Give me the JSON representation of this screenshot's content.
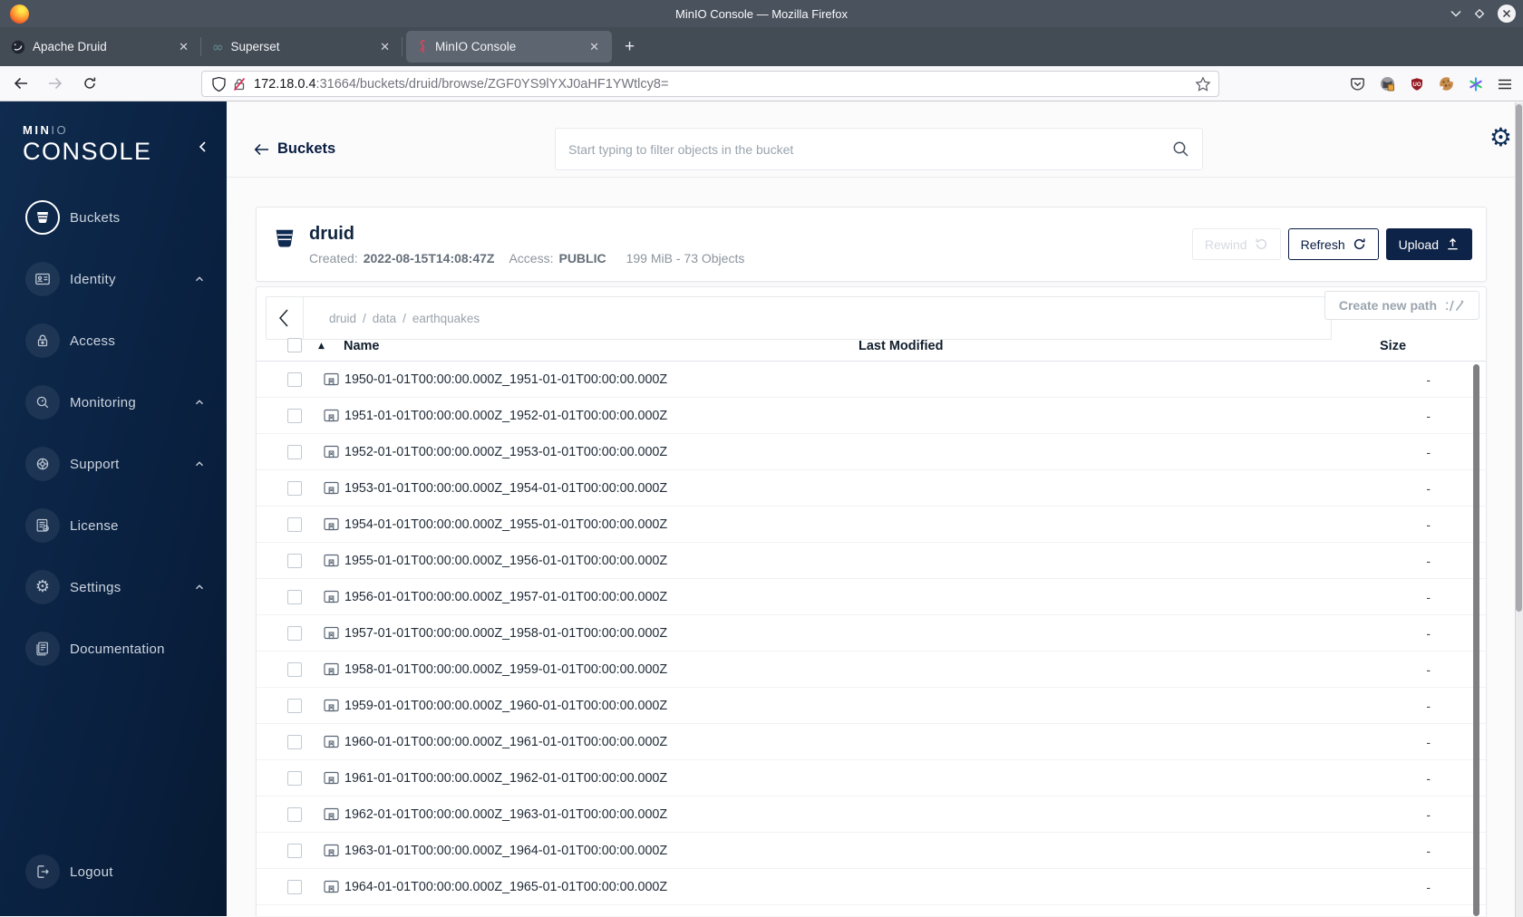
{
  "window": {
    "title": "MinIO Console — Mozilla Firefox"
  },
  "tabs": [
    {
      "label": "Apache Druid",
      "close": "✕"
    },
    {
      "label": "Superset",
      "close": "✕"
    },
    {
      "label": "MinIO Console",
      "close": "✕",
      "active": true
    }
  ],
  "browser": {
    "url_host": "172.18.0.4",
    "url_rest": ":31664/buckets/druid/browse/ZGF0YS9lYXJ0aHF1YWtlcy8="
  },
  "sidebar": {
    "logo_top": "MIN",
    "logo_top_light": "IO",
    "logo_main": "CONSOLE",
    "items": [
      {
        "label": "Buckets",
        "active": true,
        "has_chevron": false
      },
      {
        "label": "Identity",
        "active": false,
        "has_chevron": true
      },
      {
        "label": "Access",
        "active": false,
        "has_chevron": false
      },
      {
        "label": "Monitoring",
        "active": false,
        "has_chevron": true
      },
      {
        "label": "Support",
        "active": false,
        "has_chevron": true
      },
      {
        "label": "License",
        "active": false,
        "has_chevron": false
      },
      {
        "label": "Settings",
        "active": false,
        "has_chevron": true
      },
      {
        "label": "Documentation",
        "active": false,
        "has_chevron": false
      }
    ],
    "logout_label": "Logout"
  },
  "header": {
    "back_label": "Buckets",
    "search_placeholder": "Start typing to filter objects in the bucket"
  },
  "bucket": {
    "name": "druid",
    "created_label": "Created:",
    "created": "2022-08-15T14:08:47Z",
    "access_label": "Access:",
    "access": "PUBLIC",
    "usage": "199 MiB - 73 Objects",
    "rewind_label": "Rewind",
    "refresh_label": "Refresh",
    "upload_label": "Upload"
  },
  "browse": {
    "breadcrumb": [
      "druid",
      "data",
      "earthquakes"
    ],
    "breadcrumb_separator": "/",
    "create_path_label": "Create new path",
    "columns": {
      "name": "Name",
      "last_modified": "Last Modified",
      "size": "Size"
    },
    "sort_indicator": "▲",
    "rows": [
      {
        "name": "1950-01-01T00:00:00.000Z_1951-01-01T00:00:00.000Z",
        "size": "-"
      },
      {
        "name": "1951-01-01T00:00:00.000Z_1952-01-01T00:00:00.000Z",
        "size": "-"
      },
      {
        "name": "1952-01-01T00:00:00.000Z_1953-01-01T00:00:00.000Z",
        "size": "-"
      },
      {
        "name": "1953-01-01T00:00:00.000Z_1954-01-01T00:00:00.000Z",
        "size": "-"
      },
      {
        "name": "1954-01-01T00:00:00.000Z_1955-01-01T00:00:00.000Z",
        "size": "-"
      },
      {
        "name": "1955-01-01T00:00:00.000Z_1956-01-01T00:00:00.000Z",
        "size": "-"
      },
      {
        "name": "1956-01-01T00:00:00.000Z_1957-01-01T00:00:00.000Z",
        "size": "-"
      },
      {
        "name": "1957-01-01T00:00:00.000Z_1958-01-01T00:00:00.000Z",
        "size": "-"
      },
      {
        "name": "1958-01-01T00:00:00.000Z_1959-01-01T00:00:00.000Z",
        "size": "-"
      },
      {
        "name": "1959-01-01T00:00:00.000Z_1960-01-01T00:00:00.000Z",
        "size": "-"
      },
      {
        "name": "1960-01-01T00:00:00.000Z_1961-01-01T00:00:00.000Z",
        "size": "-"
      },
      {
        "name": "1961-01-01T00:00:00.000Z_1962-01-01T00:00:00.000Z",
        "size": "-"
      },
      {
        "name": "1962-01-01T00:00:00.000Z_1963-01-01T00:00:00.000Z",
        "size": "-"
      },
      {
        "name": "1963-01-01T00:00:00.000Z_1964-01-01T00:00:00.000Z",
        "size": "-"
      },
      {
        "name": "1964-01-01T00:00:00.000Z_1965-01-01T00:00:00.000Z",
        "size": "-"
      }
    ]
  },
  "colors": {
    "accent_navy": "#081c42",
    "upload_button_bg": "#0d2348",
    "sidebar_gradient_from": "#0f2b4e",
    "sidebar_gradient_to": "#071a33",
    "ublock_red": "#941c24",
    "insecure_strike_red": "#e22850"
  }
}
